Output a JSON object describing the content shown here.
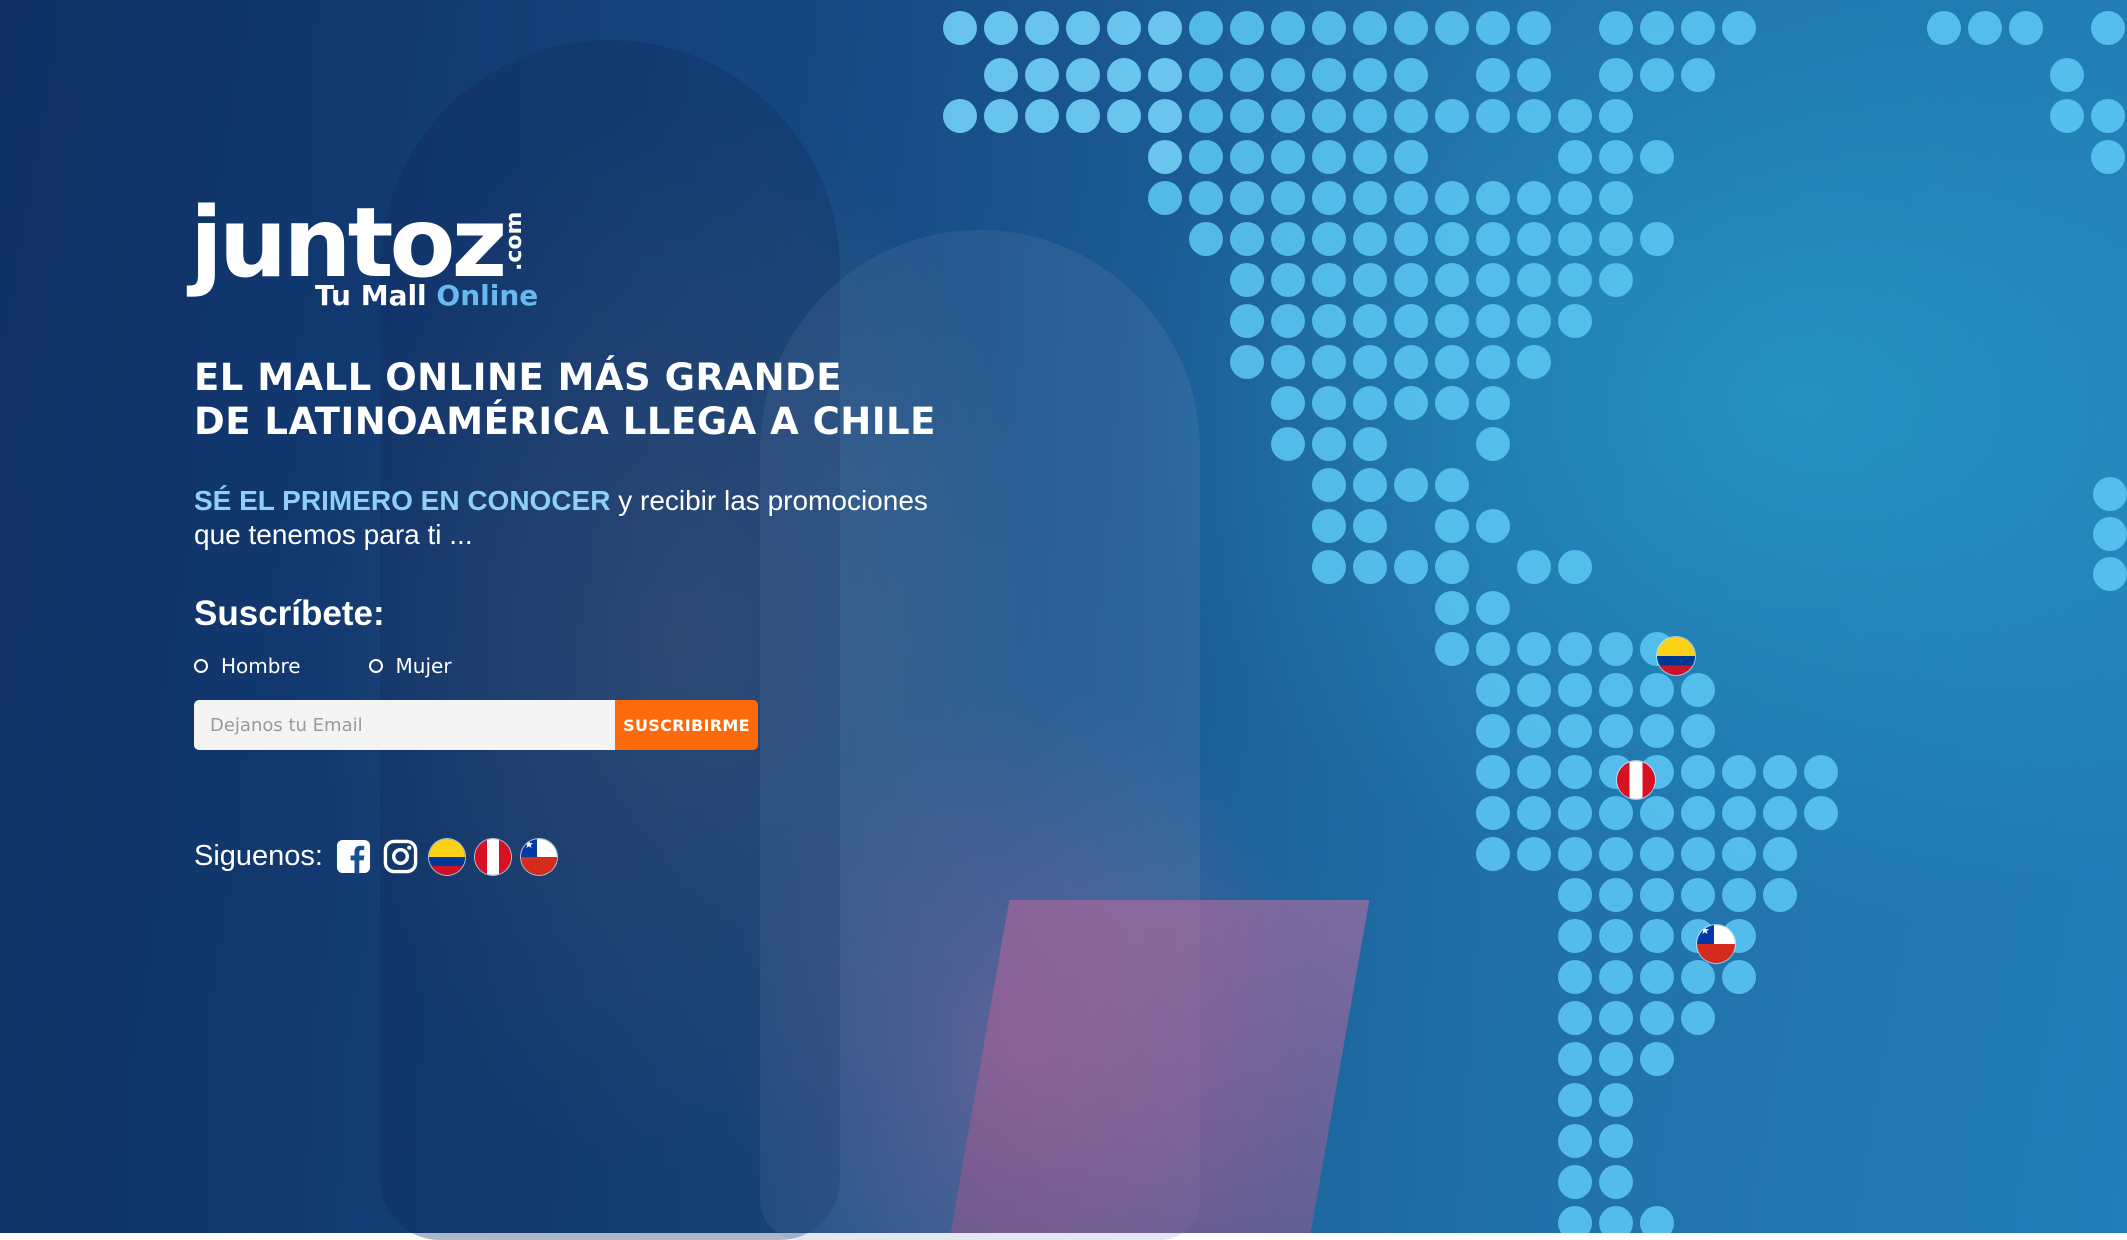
{
  "brand": {
    "logo_word": "juntoz",
    "logo_domain": ".com",
    "tagline_main": "Tu Mall",
    "tagline_accent": "Online"
  },
  "hero": {
    "headline_line1": "EL MALL ONLINE MÁS GRANDE",
    "headline_line2": "DE LATINOAMÉRICA LLEGA A CHILE",
    "sub_highlight": "SÉ EL PRIMERO EN CONOCER",
    "sub_rest_line1": " y recibir las promociones",
    "sub_line2": "que tenemos para ti ..."
  },
  "subscribe": {
    "title": "Suscríbete:",
    "gender_options": [
      "Hombre",
      "Mujer"
    ],
    "email_placeholder": "Dejanos tu Email",
    "email_value": "",
    "button_label": "SUSCRIBIRME"
  },
  "social": {
    "label": "Siguenos:",
    "links": [
      "facebook-icon",
      "instagram-icon",
      "colombia-flag-icon",
      "peru-flag-icon",
      "chile-flag-icon"
    ]
  },
  "map_flags": [
    "colombia-flag-icon",
    "peru-flag-icon",
    "chile-flag-icon"
  ],
  "colors": {
    "accent_orange": "#fb6a0b",
    "highlight_blue": "#8fd0f7",
    "dot_blue": "#5bc6f2",
    "background_blue": "#1a5690"
  }
}
